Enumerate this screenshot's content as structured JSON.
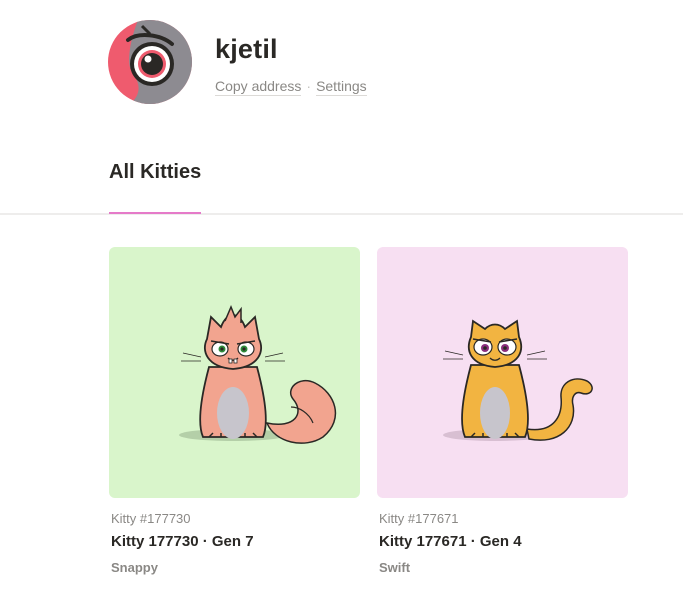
{
  "profile": {
    "username": "kjetil",
    "copy_address": "Copy address",
    "separator": "·",
    "settings": "Settings"
  },
  "tabs": {
    "active": "All Kitties",
    "accent": "#e57ac9"
  },
  "kitties": [
    {
      "id_label": "Kitty #177730",
      "name": "Kitty 177730 · Gen 7",
      "status": "Snappy",
      "background": "#d9f5cb",
      "body_color": "#f2a48f"
    },
    {
      "id_label": "Kitty #177671",
      "name": "Kitty 177671 · Gen 4",
      "status": "Swift",
      "background": "#f7dff2",
      "body_color": "#f2b441"
    }
  ]
}
